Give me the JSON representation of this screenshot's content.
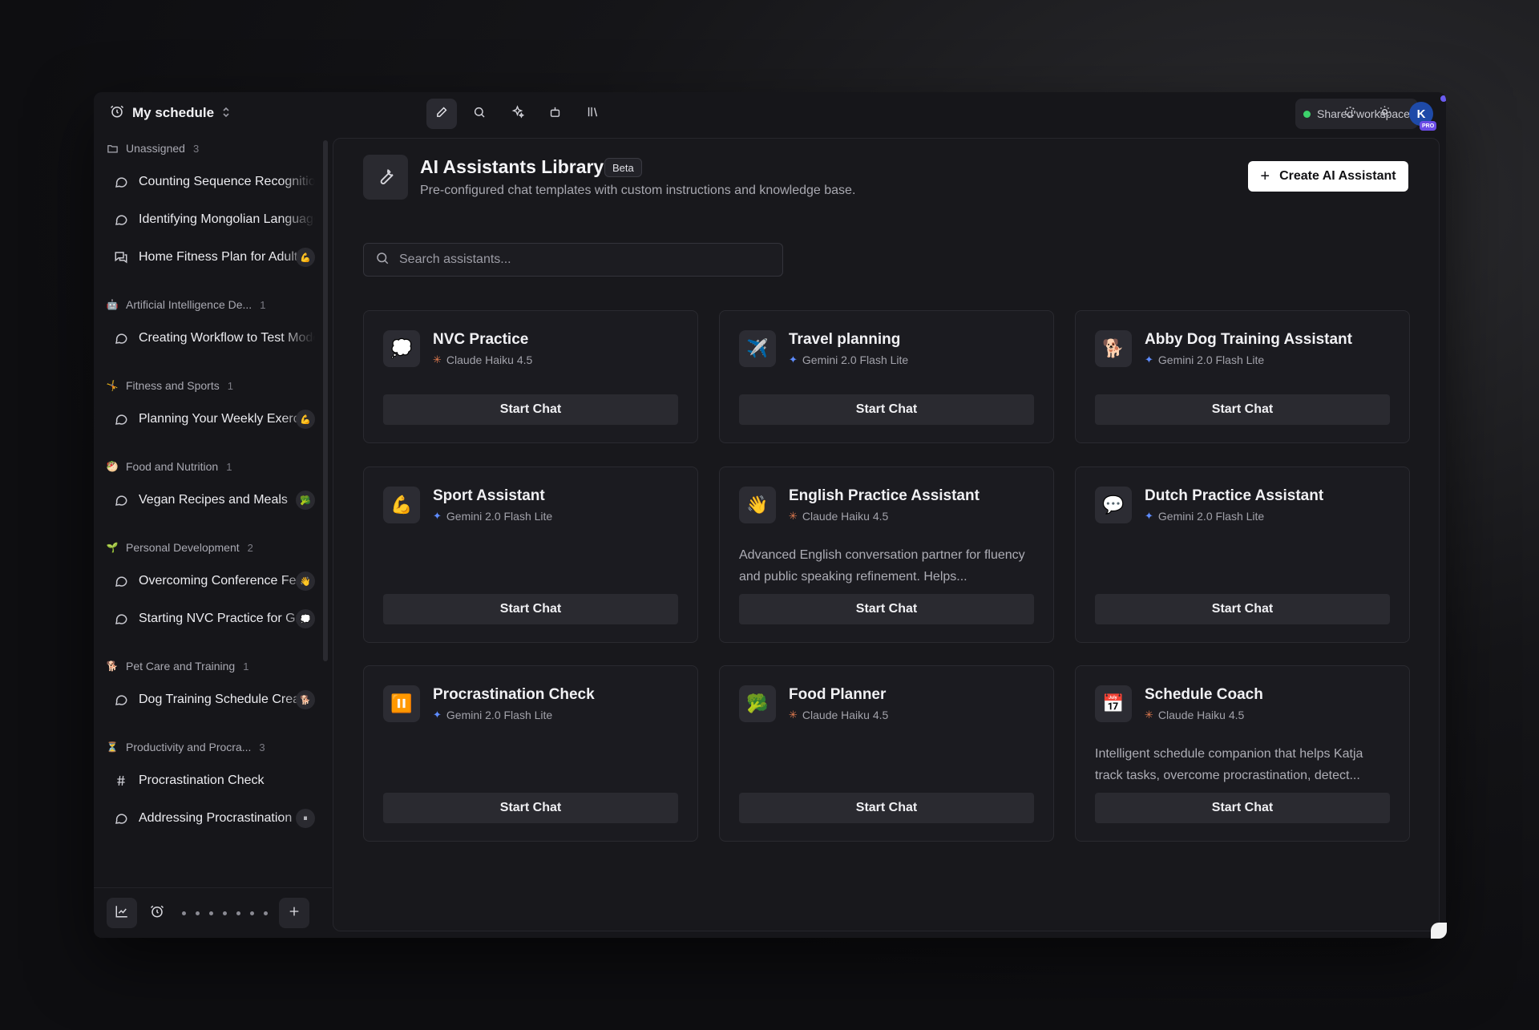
{
  "sidebar": {
    "workspace_title": "My schedule",
    "groups": [
      {
        "name": "Unassigned",
        "count": "3",
        "icon": "folder-icon",
        "chats": [
          {
            "title": "Counting Sequence Recognition",
            "icon": "chat-bubble-icon",
            "badge": ""
          },
          {
            "title": "Identifying Mongolian Language",
            "icon": "chat-bubble-icon",
            "badge": ""
          },
          {
            "title": "Home Fitness Plan for Adults",
            "icon": "chats-icon",
            "badge": "arm-icon"
          }
        ]
      },
      {
        "name": "Artificial Intelligence De...",
        "count": "1",
        "icon": "robot-icon",
        "chats": [
          {
            "title": "Creating Workflow to Test Models",
            "icon": "chat-bubble-icon",
            "badge": ""
          }
        ]
      },
      {
        "name": "Fitness and Sports",
        "count": "1",
        "icon": "gymnast-icon",
        "chats": [
          {
            "title": "Planning Your Weekly Exercise",
            "icon": "chat-bubble-icon",
            "badge": "arm-icon"
          }
        ]
      },
      {
        "name": "Food and Nutrition",
        "count": "1",
        "icon": "food-icon",
        "chats": [
          {
            "title": "Vegan Recipes and Meals",
            "icon": "chat-bubble-icon",
            "badge": "broccoli-icon"
          }
        ]
      },
      {
        "name": "Personal Development",
        "count": "2",
        "icon": "seedling-icon",
        "chats": [
          {
            "title": "Overcoming Conference Fear",
            "icon": "chat-bubble-icon",
            "badge": "wave-icon"
          },
          {
            "title": "Starting NVC Practice for Growth",
            "icon": "chat-bubble-icon",
            "badge": "thought-icon"
          }
        ]
      },
      {
        "name": "Pet Care and Training",
        "count": "1",
        "icon": "dog-icon",
        "chats": [
          {
            "title": "Dog Training Schedule Creation",
            "icon": "chat-bubble-icon",
            "badge": "dog-icon"
          }
        ]
      },
      {
        "name": "Productivity and Procra...",
        "count": "3",
        "icon": "hourglass-icon",
        "chats": [
          {
            "title": "Procrastination Check",
            "icon": "hash-icon",
            "badge": ""
          },
          {
            "title": "Addressing Procrastination",
            "icon": "chat-bubble-icon",
            "badge": "pause-icon"
          }
        ]
      }
    ]
  },
  "topbar": {
    "shared_label": "Shared workspace",
    "avatar_initial": "K",
    "pro_label": "PRO"
  },
  "main": {
    "title": "AI Assistants Library",
    "badge": "Beta",
    "subtitle": "Pre-configured chat templates with custom instructions and knowledge base.",
    "create_label": "Create AI Assistant",
    "search_placeholder": "Search assistants...",
    "start_label": "Start Chat",
    "cards": [
      {
        "name": "NVC Practice",
        "model": "Claude Haiku 4.5",
        "provider": "claude",
        "icon": "thought-icon",
        "glyph": "💭",
        "desc": ""
      },
      {
        "name": "Travel planning",
        "model": "Gemini 2.0 Flash Lite",
        "provider": "gemini",
        "icon": "airplane-icon",
        "glyph": "✈️",
        "desc": ""
      },
      {
        "name": "Abby Dog Training Assistant",
        "model": "Gemini 2.0 Flash Lite",
        "provider": "gemini",
        "icon": "dog-icon",
        "glyph": "🐕",
        "desc": ""
      },
      {
        "name": "Sport Assistant",
        "model": "Gemini 2.0 Flash Lite",
        "provider": "gemini",
        "icon": "arm-icon",
        "glyph": "💪",
        "desc": ""
      },
      {
        "name": "English Practice Assistant",
        "model": "Claude Haiku 4.5",
        "provider": "claude",
        "icon": "wave-icon",
        "glyph": "👋",
        "desc": "Advanced English conversation partner for fluency and public speaking refinement. Helps..."
      },
      {
        "name": "Dutch Practice Assistant",
        "model": "Gemini 2.0 Flash Lite",
        "provider": "gemini",
        "icon": "speech-bubble-icon",
        "glyph": "💬",
        "desc": ""
      },
      {
        "name": "Procrastination Check",
        "model": "Gemini 2.0 Flash Lite",
        "provider": "gemini",
        "icon": "pause-icon",
        "glyph": "⏸️",
        "desc": ""
      },
      {
        "name": "Food Planner",
        "model": "Claude Haiku 4.5",
        "provider": "claude",
        "icon": "broccoli-icon",
        "glyph": "🥦",
        "desc": ""
      },
      {
        "name": "Schedule Coach",
        "model": "Claude Haiku 4.5",
        "provider": "claude",
        "icon": "calendar-icon",
        "glyph": "📅",
        "desc": "Intelligent schedule companion that helps Katja track tasks, overcome procrastination, detect..."
      }
    ]
  }
}
